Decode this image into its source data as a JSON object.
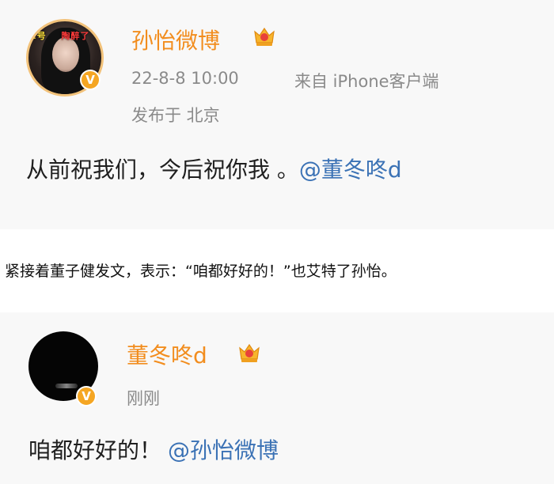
{
  "post1": {
    "author": "孙怡微博",
    "time": "22-8-8 10:00",
    "source": "来自 iPhone客户端",
    "location": "发布于 北京",
    "text": "从前祝我们，今后祝你我 。",
    "mention": "@董冬咚d",
    "avatar_sticker_left": "2号",
    "avatar_sticker_right": "陶醉了"
  },
  "caption": "紧接着董子健发文，表示：“咱都好好的！”也艾特了孙怡。",
  "post2": {
    "author": "董冬咚d",
    "time": "刚刚",
    "text": "咱都好好的！",
    "mention": "@孙怡微博"
  },
  "badges": {
    "verified_symbol": "V",
    "verified_color": "#f5a623"
  },
  "colors": {
    "name": "#f28d1e",
    "mention": "#3b72b5",
    "meta": "#8a8a8a"
  }
}
